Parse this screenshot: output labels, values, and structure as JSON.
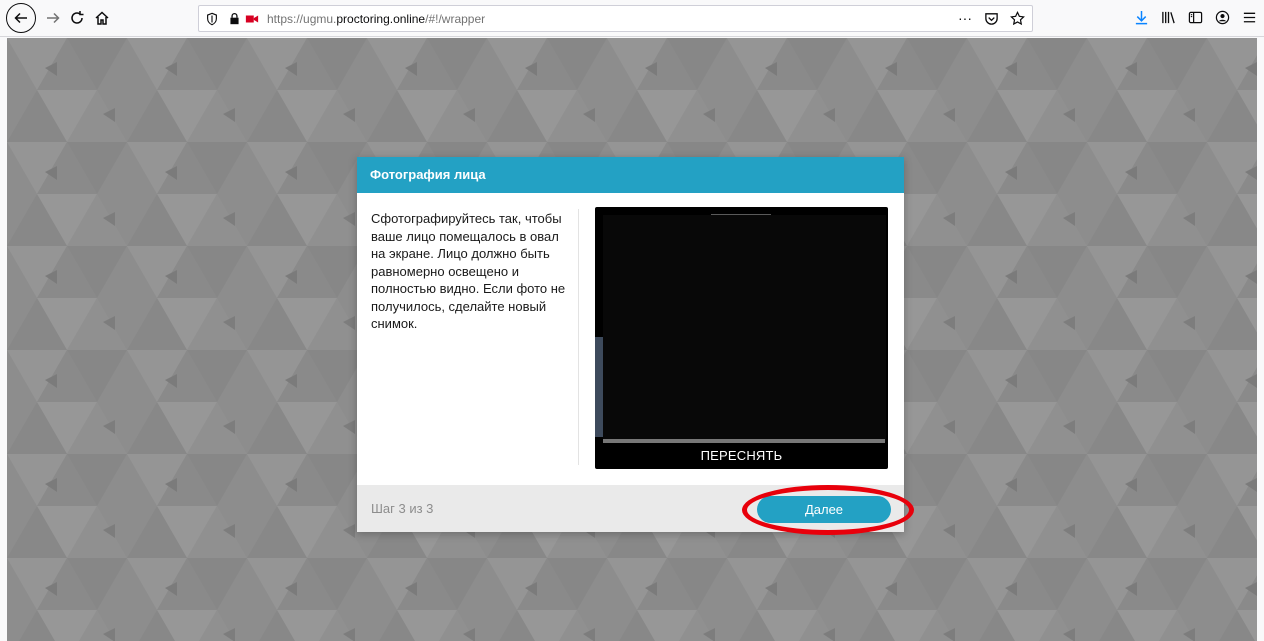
{
  "browser": {
    "url_prefix": "https://ugmu.",
    "url_host": "proctoring.online",
    "url_suffix": "/#!/wrapper",
    "page_actions_label": "···",
    "icons": [
      "back-icon",
      "forward-icon",
      "reload-icon",
      "home-icon",
      "shield-icon",
      "lock-icon",
      "camera-icon",
      "pocket-icon",
      "bookmark-star-icon",
      "download-icon",
      "library-icon",
      "sidebar-icon",
      "account-icon",
      "menu-icon"
    ]
  },
  "modal": {
    "title": "Фотография лица",
    "instructions": "Сфотографируйтесь так, чтобы ваше лицо помещалось в овал на экране. Лицо должно быть равномерно освещено и полностью видно. Если фото не получилось, сделайте новый снимок.",
    "retake_label": "ПЕРЕСНЯТЬ",
    "step_text": "Шаг 3 из 3",
    "next_label": "Далее"
  },
  "colors": {
    "accent": "#23a1c4",
    "highlight": "#e8000b",
    "background": "#8c8c8c"
  }
}
